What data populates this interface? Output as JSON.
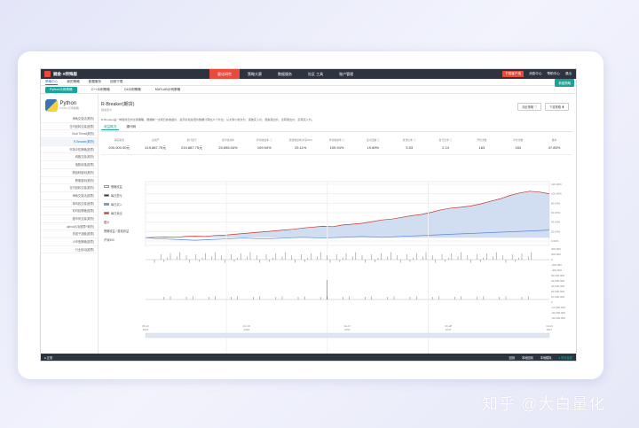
{
  "app": {
    "brand": "掘金·X特殊版",
    "menus": [
      "量化研究",
      "策略大赛",
      "数据服务",
      "社区 工具",
      "账户管理"
    ],
    "active_menu": 0,
    "top_right": [
      "下载客户端",
      "消息中心",
      "帮助中心",
      "退出"
    ],
    "new_button": "新建策略"
  },
  "subnav": [
    "策略中心",
    "我的策略",
    "数据服务",
    "回测下载"
  ],
  "lang_tabs": [
    "Python示例策略",
    "C++示例策略",
    "C#示例策略",
    "MATLAB示例策略"
  ],
  "sidebar": {
    "lang_name": "Python",
    "lang_sub": "Python示例策略",
    "items": [
      "海龟交易法(期货)",
      "日内回转交易(股票)",
      "Dual Thrust(期货)",
      "R-Breaker(期货)",
      "市场中性策略(股票)",
      "网格交易(期货)",
      "指数增强(股票)",
      "跨品种套利(期货)",
      "跨期套利(期货)",
      "日内回转交易(期货)",
      "海龟交易法(股票)",
      "单均线交易(股票)",
      "双均线策略(股票)",
      "做市商交易(期货)",
      "alpha对冲(股票+期货)",
      "多因子选股(股票)",
      "小市值策略(股票)",
      "行业轮动(股票)"
    ],
    "active_index": 3
  },
  "strategy": {
    "title": "R-Breaker(期货)",
    "author": "掘金官方",
    "buttons": [
      "用此策略 ▽",
      "下载策略 ⬆"
    ],
    "description": "R-Breaker是一种短线日内交易策略，根据前一交易日的收盘价、最高价和最低价数据计算出六个价位，从大到小依次为：突破买入价、观察卖出价、反转卖出价、反转买入价。"
  },
  "tabs": [
    "收益概况",
    "源代码"
  ],
  "metrics": [
    {
      "label": "期初资金",
      "value": "200,000.00元"
    },
    {
      "label": "总资产",
      "value": "419,887.75元"
    },
    {
      "label": "累计盈亏",
      "value": "219,887.75元"
    },
    {
      "label": "累计收益率",
      "value": "25,695.04%"
    },
    {
      "label": "年化收益率 ⓘ",
      "value": "109.94%"
    },
    {
      "label": "基准收益率(沪深300)",
      "value": "25.11%"
    },
    {
      "label": "年化收益率 ⓘ",
      "value": "109.94%"
    },
    {
      "label": "最大回撤 ⓘ",
      "value": "19.89%"
    },
    {
      "label": "夏普比率 ⓘ",
      "value": "3.53"
    },
    {
      "label": "盈亏比率 ⓘ",
      "value": "2.14"
    },
    {
      "label": "开仓次数",
      "value": "163"
    },
    {
      "label": "平仓次数",
      "value": "163"
    },
    {
      "label": "胜率",
      "value": "47.85%"
    }
  ],
  "legend": [
    {
      "label": "策略收益",
      "color": "#ffffff"
    },
    {
      "label": "每日盈亏",
      "color": "#2d3440"
    },
    {
      "label": "每日买入",
      "color": "#6aa0c8"
    },
    {
      "label": "每日卖出",
      "color": "#c9453b"
    },
    {
      "label": "图示",
      "color": ""
    },
    {
      "label": "策略收益 / 基准收益",
      "color": ""
    },
    {
      "label": "沪深300",
      "color": ""
    }
  ],
  "chart_axes": {
    "y_main": [
      "120.00%",
      "100.00%",
      "80.00%",
      "60.00%",
      "40.00%",
      "20.00%",
      "0.00%"
    ],
    "y_pl": [
      "400,000",
      "200,000",
      "0",
      "-200,000",
      "-400,000"
    ],
    "y_trade": [
      "50,000,000",
      "40,000,000",
      "30,000,000",
      "20,000,000",
      "10,000,000",
      "0",
      "-10,000,000",
      "-20,000,000",
      "-30,000,000"
    ],
    "x": [
      "06-12\n2016",
      "10-19\n2016",
      "02-17\n2017",
      "06-28\n2017",
      "10-24\n2017"
    ]
  },
  "statusbar": {
    "left": "● 正常",
    "items": [
      "回测",
      "本地回测",
      "本地模拟"
    ],
    "right_btn": "● 联系客服"
  },
  "watermark": "知乎 @大白量化",
  "chart_data": {
    "type": "line",
    "x_range": [
      "06-12 2016",
      "10-24 2017"
    ],
    "series": [
      {
        "name": "策略收益",
        "color": "#c0392b",
        "values": [
          0,
          1,
          2,
          1,
          3,
          4,
          3,
          5,
          6,
          8,
          10,
          12,
          14,
          16,
          18,
          20,
          23,
          25,
          27,
          26,
          30,
          32,
          34,
          38,
          42,
          44,
          48,
          52,
          55,
          60,
          66,
          70,
          72,
          75,
          80,
          86,
          92,
          100,
          106,
          110,
          108,
          104
        ]
      },
      {
        "name": "沪深300",
        "color": "#5b8ad6",
        "values": [
          0,
          -2,
          -3,
          -4,
          -5,
          -6,
          -5,
          -4,
          -3,
          -2,
          -1,
          -2,
          -3,
          -2,
          -1,
          0,
          1,
          0,
          -1,
          0,
          1,
          2,
          3,
          2,
          1,
          2,
          3,
          4,
          5,
          6,
          7,
          8,
          9,
          10,
          11,
          12,
          13,
          14,
          15,
          16,
          17,
          18
        ]
      }
    ],
    "ylim": [
      -10,
      120
    ]
  }
}
